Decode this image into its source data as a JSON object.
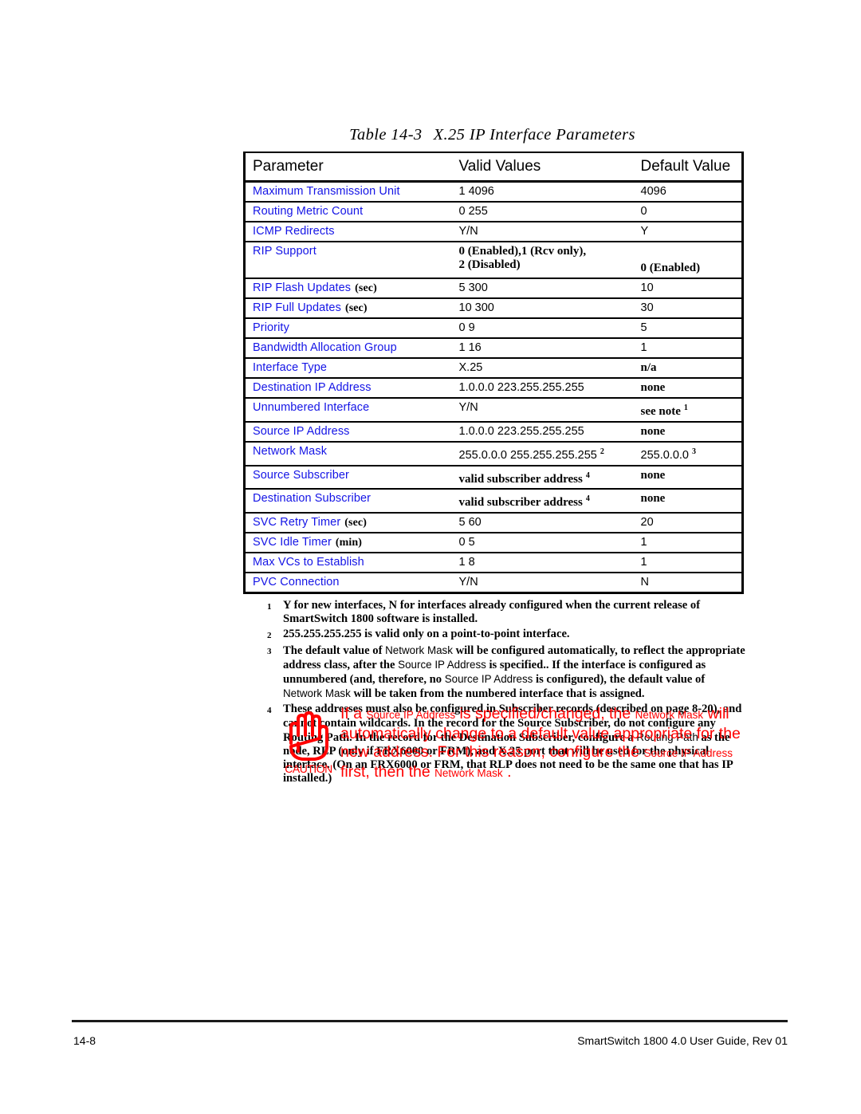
{
  "page": {
    "number": "14-8",
    "footer_right": "SmartSwitch 1800 4.0 User Guide, Rev 01"
  },
  "table": {
    "caption_number": "Table 14-3",
    "caption_title": "X.25 IP Interface Parameters",
    "columns": [
      "Parameter",
      "Valid Values",
      "Default Value"
    ],
    "rows": [
      {
        "parameter": "Maximum Transmission Unit",
        "unit": "",
        "valid": "1 4096",
        "default": "4096"
      },
      {
        "parameter": "Routing Metric Count",
        "unit": "",
        "valid": "0 255",
        "default": "0"
      },
      {
        "parameter": "ICMP Redirects",
        "unit": "",
        "valid": "Y/N",
        "default": "Y"
      },
      {
        "parameter": "RIP Support",
        "unit": "",
        "valid_line1": "0 (Enabled),1 (Rcv only),",
        "valid_line2": "2 (Disabled)",
        "default": "0 (Enabled)"
      },
      {
        "parameter": "RIP Flash Updates",
        "unit": "(sec)",
        "valid": "5 300",
        "default": "10"
      },
      {
        "parameter": "RIP Full Updates",
        "unit": "(sec)",
        "valid": "10 300",
        "default": "30"
      },
      {
        "parameter": "Priority",
        "unit": "",
        "valid": "0 9",
        "default": "5"
      },
      {
        "parameter": "Bandwidth Allocation Group",
        "unit": "",
        "valid": "1 16",
        "default": "1"
      },
      {
        "parameter": "Interface Type",
        "unit": "",
        "valid": "X.25",
        "default": "n/a"
      },
      {
        "parameter": "Destination IP Address",
        "unit": "",
        "valid": "1.0.0.0 223.255.255.255",
        "default": "none"
      },
      {
        "parameter": "Unnumbered Interface",
        "unit": "",
        "valid": "Y/N",
        "default": "see note",
        "default_note": "1"
      },
      {
        "parameter": "Source IP Address",
        "unit": "",
        "valid": "1.0.0.0 223.255.255.255",
        "default": "none"
      },
      {
        "parameter": "Network Mask",
        "unit": "",
        "valid": "255.0.0.0 255.255.255.255",
        "valid_note": "2",
        "default": "255.0.0.0",
        "default_note": "3"
      },
      {
        "parameter": "Source Subscriber",
        "unit": "",
        "valid": "valid subscriber address",
        "valid_note": "4",
        "default": "none"
      },
      {
        "parameter": "Destination Subscriber",
        "unit": "",
        "valid": "valid subscriber address",
        "valid_note": "4",
        "default": "none"
      },
      {
        "parameter": "SVC Retry Timer",
        "unit": "(sec)",
        "valid": "5 60",
        "default": "20"
      },
      {
        "parameter": "SVC Idle Timer",
        "unit": "(min)",
        "valid": "0 5",
        "default": "1"
      },
      {
        "parameter": "Max VCs to Establish",
        "unit": "",
        "valid": "1 8",
        "default": "1"
      },
      {
        "parameter": "PVC Connection",
        "unit": "",
        "valid": "Y/N",
        "default": "N"
      }
    ]
  },
  "notes": [
    {
      "num": "1",
      "parts": [
        {
          "t": "Y for new interfaces, N for interfaces already configured when the current release of SmartSwitch 1800 software is installed.",
          "style": "bold"
        }
      ]
    },
    {
      "num": "2",
      "parts": [
        {
          "t": "255.255.255.255 is valid only on a point-to-point interface.",
          "style": "bold"
        }
      ]
    },
    {
      "num": "3",
      "parts": [
        {
          "t": "The default value of ",
          "style": "bold"
        },
        {
          "t": "Network Mask",
          "style": "field"
        },
        {
          "t": " will be configured automatically, to reflect the appropriate address class, after the ",
          "style": "bold"
        },
        {
          "t": "Source IP Address",
          "style": "field"
        },
        {
          "t": " is specified.. If the interface is configured as unnumbered (and, therefore, no ",
          "style": "bold"
        },
        {
          "t": "Source IP Address",
          "style": "field"
        },
        {
          "t": " is configured), the default value of ",
          "style": "bold"
        },
        {
          "t": "Network Mask",
          "style": "field"
        },
        {
          "t": " will be taken from the numbered interface that is assigned.",
          "style": "bold"
        }
      ]
    },
    {
      "num": "4",
      "parts": [
        {
          "t": "These addresses must also be configured in Subscriber records (described on page 8-20), and cannot contain wildcards. In the record for the Source Subscriber, do not configure any Routing Path. In the record for the Destination Subscriber, configure a ",
          "style": "bold"
        },
        {
          "t": "Routing Path",
          "style": "field"
        },
        {
          "t": " as the node, RLP (only if FRX6000 or FRM), and X.25 port that will be used for the physical interface. (On an FRX6000 or FRM, that RLP does not need to be the same one that has IP installed.)",
          "style": "bold"
        }
      ]
    }
  ],
  "caution": {
    "label": "CAUTION",
    "icon": "hand-stop-icon",
    "color": "#ff0000",
    "parts": [
      {
        "t": "If a ",
        "style": "normal"
      },
      {
        "t": "Source IP Address",
        "style": "field"
      },
      {
        "t": " is specified/changed, the ",
        "style": "normal"
      },
      {
        "t": "Network Mask",
        "style": "field"
      },
      {
        "t": " will automatically change to a default value appropriate for the new address. For this reason, configure the ",
        "style": "normal"
      },
      {
        "t": "Source IP Address",
        "style": "field"
      },
      {
        "t": " first, then the ",
        "style": "normal"
      },
      {
        "t": "Network Mask",
        "style": "field"
      },
      {
        "t": " .",
        "style": "normal"
      }
    ]
  }
}
